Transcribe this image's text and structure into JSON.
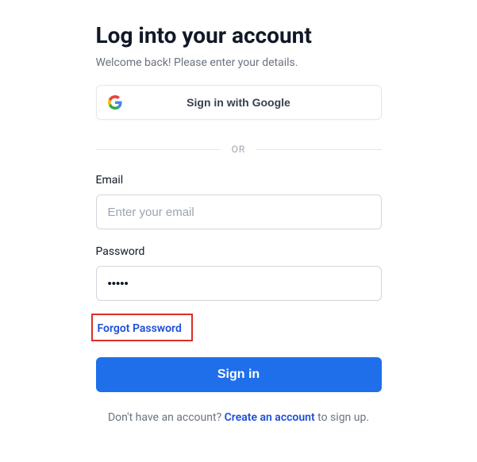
{
  "title": "Log into your account",
  "subtitle": "Welcome back! Please enter your details.",
  "google_button_label": "Sign in with Google",
  "divider_text": "OR",
  "email": {
    "label": "Email",
    "placeholder": "Enter your email",
    "value": ""
  },
  "password": {
    "label": "Password",
    "placeholder": "",
    "value": "•••••"
  },
  "forgot_password_label": "Forgot Password",
  "signin_button_label": "Sign in",
  "signup": {
    "prefix": "Don't have an account? ",
    "link": "Create an account",
    "suffix": " to sign up."
  },
  "colors": {
    "primary": "#1f6feb",
    "highlight_border": "#d93025",
    "text_muted": "#6b7280"
  }
}
